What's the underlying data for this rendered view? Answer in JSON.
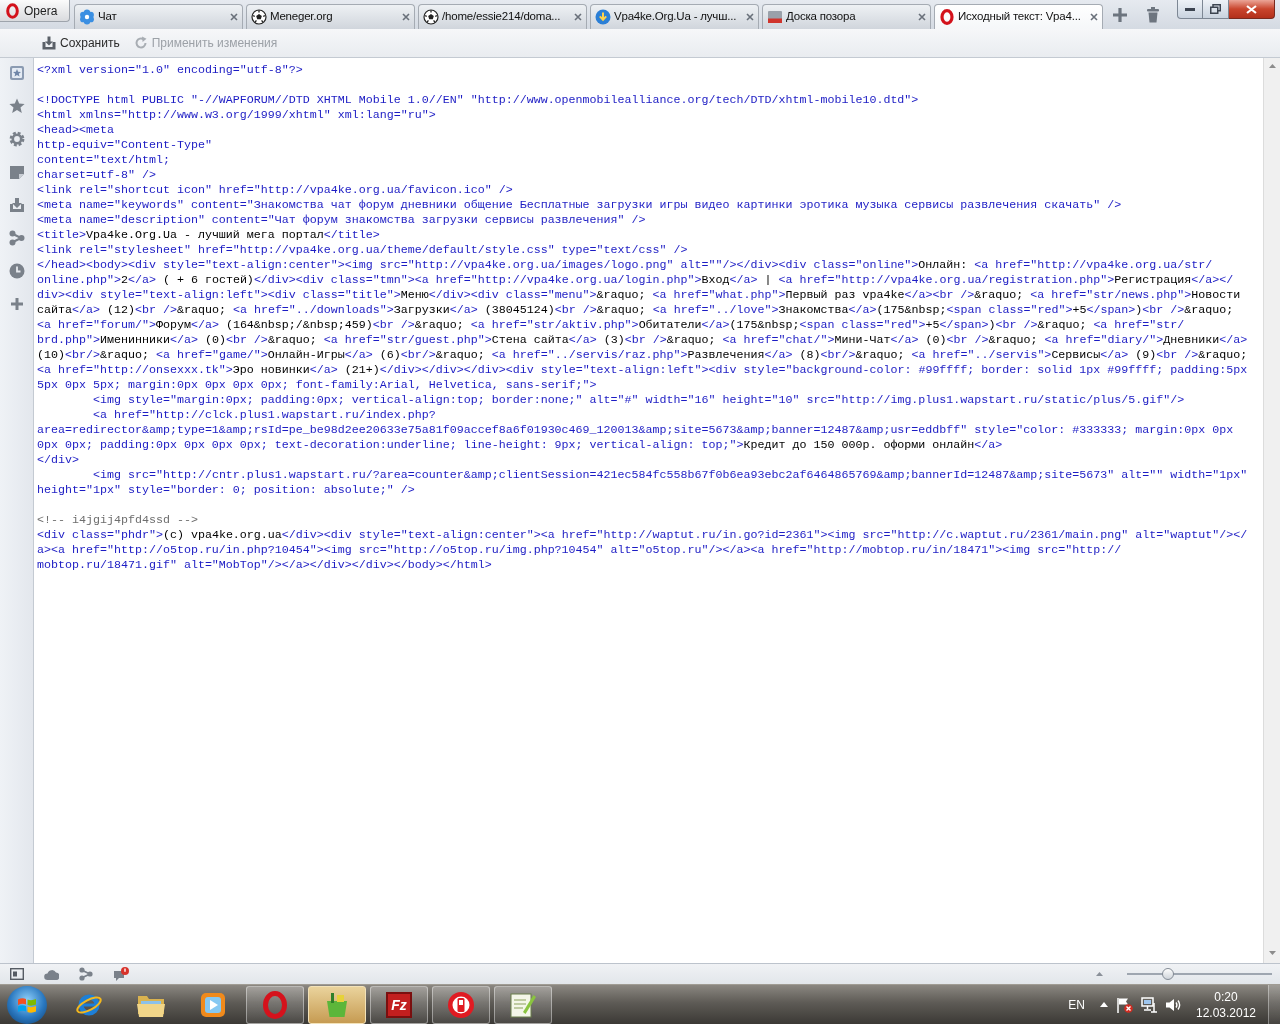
{
  "menu_button": {
    "label": "Opera"
  },
  "tabs": [
    {
      "kind": "flower",
      "title": "Чат",
      "selected": false
    },
    {
      "kind": "ball",
      "title": "Meneger.org",
      "selected": false
    },
    {
      "kind": "ball",
      "title": "/home/essie214/doma...",
      "selected": false
    },
    {
      "kind": "globe",
      "title": "Vpa4ke.Org.Ua - лучш...",
      "selected": false
    },
    {
      "kind": "board",
      "title": "Доска позора",
      "selected": false
    },
    {
      "kind": "logo",
      "title": "Исходный текст: Vpa4...",
      "selected": true
    }
  ],
  "toolbar": {
    "buttons": [
      {
        "kind": "save",
        "label": "Сохранить",
        "disabled": false
      },
      {
        "kind": "apply",
        "label": "Применить изменения",
        "disabled": true
      }
    ]
  },
  "source": {
    "lines": [
      {
        "kind": "code",
        "segments": [
          {
            "kind": "tag",
            "text": "<?xml version=\"1.0\" encoding=\"utf-8\"?>"
          }
        ]
      },
      {
        "kind": "blank"
      },
      {
        "kind": "code",
        "segments": [
          {
            "kind": "tag",
            "text": "<!DOCTYPE html PUBLIC \"-//WAPFORUM//DTD XHTML Mobile 1.0//EN\" \"http://www.openmobilealliance.org/tech/DTD/xhtml-mobile10.dtd\">"
          }
        ]
      },
      {
        "kind": "code",
        "segments": [
          {
            "kind": "tag",
            "text": "<html xmlns=\"http://www.w3.org/1999/xhtml\" xml:lang=\"ru\">"
          }
        ]
      },
      {
        "kind": "code",
        "segments": [
          {
            "kind": "tag",
            "text": "<head><meta"
          }
        ]
      },
      {
        "kind": "code",
        "segments": [
          {
            "kind": "tag",
            "text": "http-equiv=\"Content-Type\""
          }
        ]
      },
      {
        "kind": "code",
        "segments": [
          {
            "kind": "tag",
            "text": "content=\"text/html;"
          }
        ]
      },
      {
        "kind": "code",
        "segments": [
          {
            "kind": "tag",
            "text": "charset=utf-8\" />"
          }
        ]
      },
      {
        "kind": "code",
        "segments": [
          {
            "kind": "tag",
            "text": "<link rel=\"shortcut icon\" href=\"http://vpa4ke.org.ua/favicon.ico\" />"
          }
        ]
      },
      {
        "kind": "code",
        "segments": [
          {
            "kind": "tag",
            "text": "<meta name=\"keywords\" content=\"Знакомства чат форум дневники общение Бесплатные загрузки игры видео картинки эротика музыка сервисы развлечения скачать\" />"
          }
        ]
      },
      {
        "kind": "code",
        "segments": [
          {
            "kind": "tag",
            "text": "<meta name=\"description\" content=\"Чат форум знакомства загрузки сервисы развлечения\" />"
          }
        ]
      },
      {
        "kind": "code",
        "segments": [
          {
            "kind": "tag",
            "text": "<title>"
          },
          {
            "kind": "text",
            "text": "Vpa4ke.Org.Ua - лучший мега портал"
          },
          {
            "kind": "tag",
            "text": "</title>"
          }
        ]
      },
      {
        "kind": "code",
        "segments": [
          {
            "kind": "tag",
            "text": "<link rel=\"stylesheet\" href=\"http://vpa4ke.org.ua/theme/default/style.css\" type=\"text/css\" />"
          }
        ]
      },
      {
        "kind": "code",
        "segments": [
          {
            "kind": "tag",
            "text": "</head><body><div style=\"text-align:center\"><img src=\"http://vpa4ke.org.ua/images/logo.png\" alt=\"\"/></div><div class=\"online\">"
          },
          {
            "kind": "text",
            "text": "Онлайн: "
          },
          {
            "kind": "tag",
            "text": "<a href=\"http://vpa4ke.org.ua/str/"
          }
        ]
      },
      {
        "kind": "code",
        "segments": [
          {
            "kind": "tag",
            "text": "online.php\">"
          },
          {
            "kind": "text",
            "text": "2"
          },
          {
            "kind": "tag",
            "text": "</a>"
          },
          {
            "kind": "text",
            "text": " ( + 6 гостей)"
          },
          {
            "kind": "tag",
            "text": "</div><div class=\"tmn\"><a href=\"http://vpa4ke.org.ua/login.php\">"
          },
          {
            "kind": "text",
            "text": "Вход"
          },
          {
            "kind": "tag",
            "text": "</a>"
          },
          {
            "kind": "text",
            "text": " | "
          },
          {
            "kind": "tag",
            "text": "<a href=\"http://vpa4ke.org.ua/registration.php\">"
          },
          {
            "kind": "text",
            "text": "Регистрация"
          },
          {
            "kind": "tag",
            "text": "</a></"
          }
        ]
      },
      {
        "kind": "code",
        "segments": [
          {
            "kind": "tag",
            "text": "div><div style=\"text-align:left\"><div class=\"title\">"
          },
          {
            "kind": "text",
            "text": "Меню"
          },
          {
            "kind": "tag",
            "text": "</div><div class=\"menu\">"
          },
          {
            "kind": "text",
            "text": "&raquo; "
          },
          {
            "kind": "tag",
            "text": "<a href=\"what.php\">"
          },
          {
            "kind": "text",
            "text": "Первый раз vpa4ke"
          },
          {
            "kind": "tag",
            "text": "</a><br />"
          },
          {
            "kind": "text",
            "text": "&raquo; "
          },
          {
            "kind": "tag",
            "text": "<a href=\"str/news.php\">"
          },
          {
            "kind": "text",
            "text": "Новости"
          }
        ]
      },
      {
        "kind": "code",
        "segments": [
          {
            "kind": "text",
            "text": "сайта"
          },
          {
            "kind": "tag",
            "text": "</a>"
          },
          {
            "kind": "text",
            "text": " (12)"
          },
          {
            "kind": "tag",
            "text": "<br />"
          },
          {
            "kind": "text",
            "text": "&raquo; "
          },
          {
            "kind": "tag",
            "text": "<a href=\"../downloads\">"
          },
          {
            "kind": "text",
            "text": "Загрузки"
          },
          {
            "kind": "tag",
            "text": "</a>"
          },
          {
            "kind": "text",
            "text": " (38045124)"
          },
          {
            "kind": "tag",
            "text": "<br />"
          },
          {
            "kind": "text",
            "text": "&raquo; "
          },
          {
            "kind": "tag",
            "text": "<a href=\"../love\">"
          },
          {
            "kind": "text",
            "text": "Знакомства"
          },
          {
            "kind": "tag",
            "text": "</a>"
          },
          {
            "kind": "text",
            "text": "(175&nbsp;"
          },
          {
            "kind": "tag",
            "text": "<span class=\"red\">"
          },
          {
            "kind": "text",
            "text": "+5"
          },
          {
            "kind": "tag",
            "text": "</span>"
          },
          {
            "kind": "text",
            "text": ")"
          },
          {
            "kind": "tag",
            "text": "<br />"
          },
          {
            "kind": "text",
            "text": "&raquo;"
          }
        ]
      },
      {
        "kind": "code",
        "segments": [
          {
            "kind": "tag",
            "text": "<a href=\"forum/\">"
          },
          {
            "kind": "text",
            "text": "Форум"
          },
          {
            "kind": "tag",
            "text": "</a>"
          },
          {
            "kind": "text",
            "text": " (164&nbsp;/&nbsp;459)"
          },
          {
            "kind": "tag",
            "text": "<br />"
          },
          {
            "kind": "text",
            "text": "&raquo; "
          },
          {
            "kind": "tag",
            "text": "<a href=\"str/aktiv.php\">"
          },
          {
            "kind": "text",
            "text": "Обитатели"
          },
          {
            "kind": "tag",
            "text": "</a>"
          },
          {
            "kind": "text",
            "text": "(175&nbsp;"
          },
          {
            "kind": "tag",
            "text": "<span class=\"red\">"
          },
          {
            "kind": "text",
            "text": "+5"
          },
          {
            "kind": "tag",
            "text": "</span>"
          },
          {
            "kind": "text",
            "text": ")"
          },
          {
            "kind": "tag",
            "text": "<br />"
          },
          {
            "kind": "text",
            "text": "&raquo; "
          },
          {
            "kind": "tag",
            "text": "<a href=\"str/"
          }
        ]
      },
      {
        "kind": "code",
        "segments": [
          {
            "kind": "tag",
            "text": "brd.php\">"
          },
          {
            "kind": "text",
            "text": "Именинники"
          },
          {
            "kind": "tag",
            "text": "</a>"
          },
          {
            "kind": "text",
            "text": " (0)"
          },
          {
            "kind": "tag",
            "text": "<br />"
          },
          {
            "kind": "text",
            "text": "&raquo; "
          },
          {
            "kind": "tag",
            "text": "<a href=\"str/guest.php\">"
          },
          {
            "kind": "text",
            "text": "Стена сайта"
          },
          {
            "kind": "tag",
            "text": "</a>"
          },
          {
            "kind": "text",
            "text": " (3)"
          },
          {
            "kind": "tag",
            "text": "<br />"
          },
          {
            "kind": "text",
            "text": "&raquo; "
          },
          {
            "kind": "tag",
            "text": "<a href=\"chat/\">"
          },
          {
            "kind": "text",
            "text": "Мини-Чат"
          },
          {
            "kind": "tag",
            "text": "</a>"
          },
          {
            "kind": "text",
            "text": " (0)"
          },
          {
            "kind": "tag",
            "text": "<br />"
          },
          {
            "kind": "text",
            "text": "&raquo; "
          },
          {
            "kind": "tag",
            "text": "<a href=\"diary/\">"
          },
          {
            "kind": "text",
            "text": "Дневники"
          },
          {
            "kind": "tag",
            "text": "</a>"
          }
        ]
      },
      {
        "kind": "code",
        "segments": [
          {
            "kind": "text",
            "text": "(10)"
          },
          {
            "kind": "tag",
            "text": "<br/>"
          },
          {
            "kind": "text",
            "text": "&raquo; "
          },
          {
            "kind": "tag",
            "text": "<a href=\"game/\">"
          },
          {
            "kind": "text",
            "text": "Онлайн-Игры"
          },
          {
            "kind": "tag",
            "text": "</a>"
          },
          {
            "kind": "text",
            "text": " (6)"
          },
          {
            "kind": "tag",
            "text": "<br/>"
          },
          {
            "kind": "text",
            "text": "&raquo; "
          },
          {
            "kind": "tag",
            "text": "<a href=\"../servis/raz.php\">"
          },
          {
            "kind": "text",
            "text": "Развлечения"
          },
          {
            "kind": "tag",
            "text": "</a>"
          },
          {
            "kind": "text",
            "text": " (8)"
          },
          {
            "kind": "tag",
            "text": "<br/>"
          },
          {
            "kind": "text",
            "text": "&raquo; "
          },
          {
            "kind": "tag",
            "text": "<a href=\"../servis\">"
          },
          {
            "kind": "text",
            "text": "Сервисы"
          },
          {
            "kind": "tag",
            "text": "</a>"
          },
          {
            "kind": "text",
            "text": " (9)"
          },
          {
            "kind": "tag",
            "text": "<br />"
          },
          {
            "kind": "text",
            "text": "&raquo;"
          }
        ]
      },
      {
        "kind": "code",
        "segments": [
          {
            "kind": "tag",
            "text": "<a href=\"http://onsexxx.tk\">"
          },
          {
            "kind": "text",
            "text": "Эро новинки"
          },
          {
            "kind": "tag",
            "text": "</a>"
          },
          {
            "kind": "text",
            "text": " (21+)"
          },
          {
            "kind": "tag",
            "text": "</div></div></div><div style=\"text-align:left\"><div style=\"background-color: #99ffff; border: solid 1px #99ffff; padding:5px"
          }
        ]
      },
      {
        "kind": "code",
        "segments": [
          {
            "kind": "tag",
            "text": "5px 0px 5px; margin:0px 0px 0px 0px; font-family:Arial, Helvetica, sans-serif;\">"
          }
        ]
      },
      {
        "kind": "code",
        "segments": [
          {
            "kind": "tag",
            "text": "        <img style=\"margin:0px; padding:0px; vertical-align:top; border:none;\" alt=\"#\" width=\"16\" height=\"10\" src=\"http://img.plus1.wapstart.ru/static/plus/5.gif\"/>"
          }
        ]
      },
      {
        "kind": "code",
        "segments": [
          {
            "kind": "tag",
            "text": "        <a href=\"http://clck.plus1.wapstart.ru/index.php?"
          }
        ]
      },
      {
        "kind": "code",
        "segments": [
          {
            "kind": "tag",
            "text": "area=redirector&amp;type=1&amp;rsId=pe_be98d2ee20633e75a81f09accef8a6f01930c469_120013&amp;site=5673&amp;banner=12487&amp;usr=eddbff\" style=\"color: #333333; margin:0px 0px"
          }
        ]
      },
      {
        "kind": "code",
        "segments": [
          {
            "kind": "tag",
            "text": "0px 0px; padding:0px 0px 0px 0px; text-decoration:underline; line-height: 9px; vertical-align: top;\">"
          },
          {
            "kind": "text",
            "text": "Кредит до 150 000р. оформи онлайн"
          },
          {
            "kind": "tag",
            "text": "</a>"
          }
        ]
      },
      {
        "kind": "code",
        "segments": [
          {
            "kind": "tag",
            "text": "</div>"
          }
        ]
      },
      {
        "kind": "code",
        "segments": [
          {
            "kind": "tag",
            "text": "        <img src=\"http://cntr.plus1.wapstart.ru/?area=counter&amp;clientSession=421ec584fc558b67f0b6ea93ebc2af6464865769&amp;bannerId=12487&amp;site=5673\" alt=\"\" width=\"1px\""
          }
        ]
      },
      {
        "kind": "code",
        "segments": [
          {
            "kind": "tag",
            "text": "height=\"1px\" style=\"border: 0; position: absolute;\" />"
          }
        ]
      },
      {
        "kind": "blank"
      },
      {
        "kind": "code",
        "segments": [
          {
            "kind": "comment",
            "text": "<!-- i4jgij4pfd4ssd -->"
          }
        ]
      },
      {
        "kind": "code",
        "segments": [
          {
            "kind": "tag",
            "text": "<div class=\"phdr\">"
          },
          {
            "kind": "text",
            "text": "(c) vpa4ke.org.ua"
          },
          {
            "kind": "tag",
            "text": "</div><div style=\"text-align:center\"><a href=\"http://waptut.ru/in.go?id=2361\"><img src=\"http://c.waptut.ru/2361/main.png\" alt=\"waptut\"/></"
          }
        ]
      },
      {
        "kind": "code",
        "segments": [
          {
            "kind": "tag",
            "text": "a><a href=\"http://o5top.ru/in.php?10454\"><img src=\"http://o5top.ru/img.php?10454\" alt=\"o5top.ru\"/></a><a href=\"http://mobtop.ru/in/18471\"><img src=\"http://"
          }
        ]
      },
      {
        "kind": "code",
        "segments": [
          {
            "kind": "tag",
            "text": "mobtop.ru/18471.gif\" alt=\"MobTop\"/></a></div></div></body></html>"
          }
        ]
      }
    ]
  },
  "status_bar": {
    "zoom_slider": {
      "level": 0.28
    }
  },
  "taskbar": {
    "items": [
      {
        "kind": "browser",
        "running": false,
        "flashing": false
      },
      {
        "kind": "folder",
        "running": false,
        "flashing": false
      },
      {
        "kind": "player",
        "running": false,
        "flashing": false
      },
      {
        "kind": "opera",
        "running": true,
        "flashing": false
      },
      {
        "kind": "basket",
        "running": true,
        "flashing": true
      },
      {
        "kind": "filezilla",
        "glyph": "Fz",
        "running": true,
        "flashing": false
      },
      {
        "kind": "phone",
        "running": true,
        "flashing": false
      },
      {
        "kind": "notepad",
        "running": true,
        "flashing": false
      }
    ],
    "language": "EN",
    "clock": {
      "time": "0:20",
      "date": "12.03.2012"
    }
  }
}
